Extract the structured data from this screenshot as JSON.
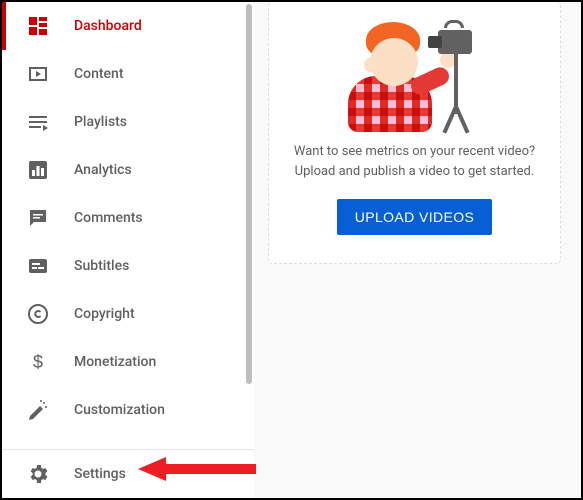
{
  "sidebar": {
    "items": [
      {
        "label": "Dashboard"
      },
      {
        "label": "Content"
      },
      {
        "label": "Playlists"
      },
      {
        "label": "Analytics"
      },
      {
        "label": "Comments"
      },
      {
        "label": "Subtitles"
      },
      {
        "label": "Copyright"
      },
      {
        "label": "Monetization"
      },
      {
        "label": "Customization"
      }
    ],
    "settings_label": "Settings"
  },
  "main": {
    "prompt_line1": "Want to see metrics on your recent video?",
    "prompt_line2": "Upload and publish a video to get started.",
    "upload_button": "UPLOAD VIDEOS"
  }
}
